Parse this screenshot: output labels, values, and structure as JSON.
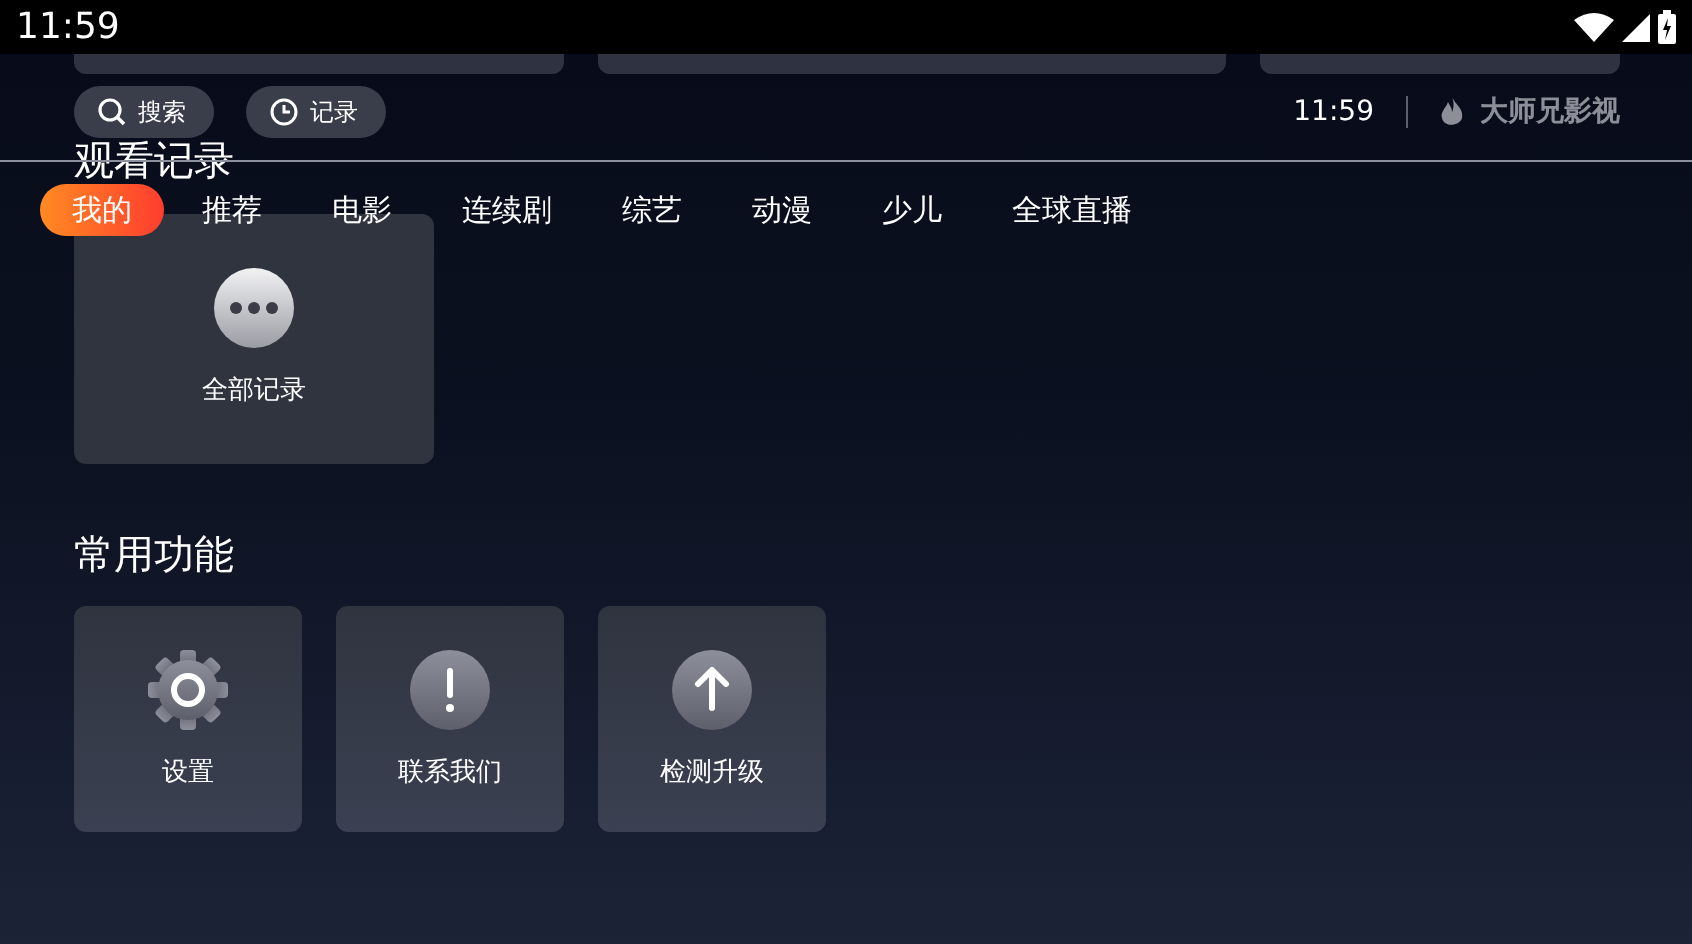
{
  "status_bar": {
    "time": "11:59"
  },
  "header": {
    "buttons": [
      {
        "kind": "search",
        "label": "搜索"
      },
      {
        "kind": "history",
        "label": "记录"
      }
    ],
    "clock": "11:59",
    "app_name": "大师兄影视"
  },
  "history": {
    "title": "观看记录",
    "items": [
      {
        "kind": "more",
        "label": "全部记录"
      }
    ]
  },
  "tabs": [
    {
      "label": "我的",
      "selected": true
    },
    {
      "label": "推荐",
      "selected": false
    },
    {
      "label": "电影",
      "selected": false
    },
    {
      "label": "连续剧",
      "selected": false
    },
    {
      "label": "综艺",
      "selected": false
    },
    {
      "label": "动漫",
      "selected": false
    },
    {
      "label": "少儿",
      "selected": false
    },
    {
      "label": "全球直播",
      "selected": false
    }
  ],
  "functions": {
    "title": "常用功能",
    "items": [
      {
        "kind": "settings",
        "label": "设置"
      },
      {
        "kind": "contact",
        "label": "联系我们"
      },
      {
        "kind": "upgrade",
        "label": "检测升级"
      }
    ]
  }
}
